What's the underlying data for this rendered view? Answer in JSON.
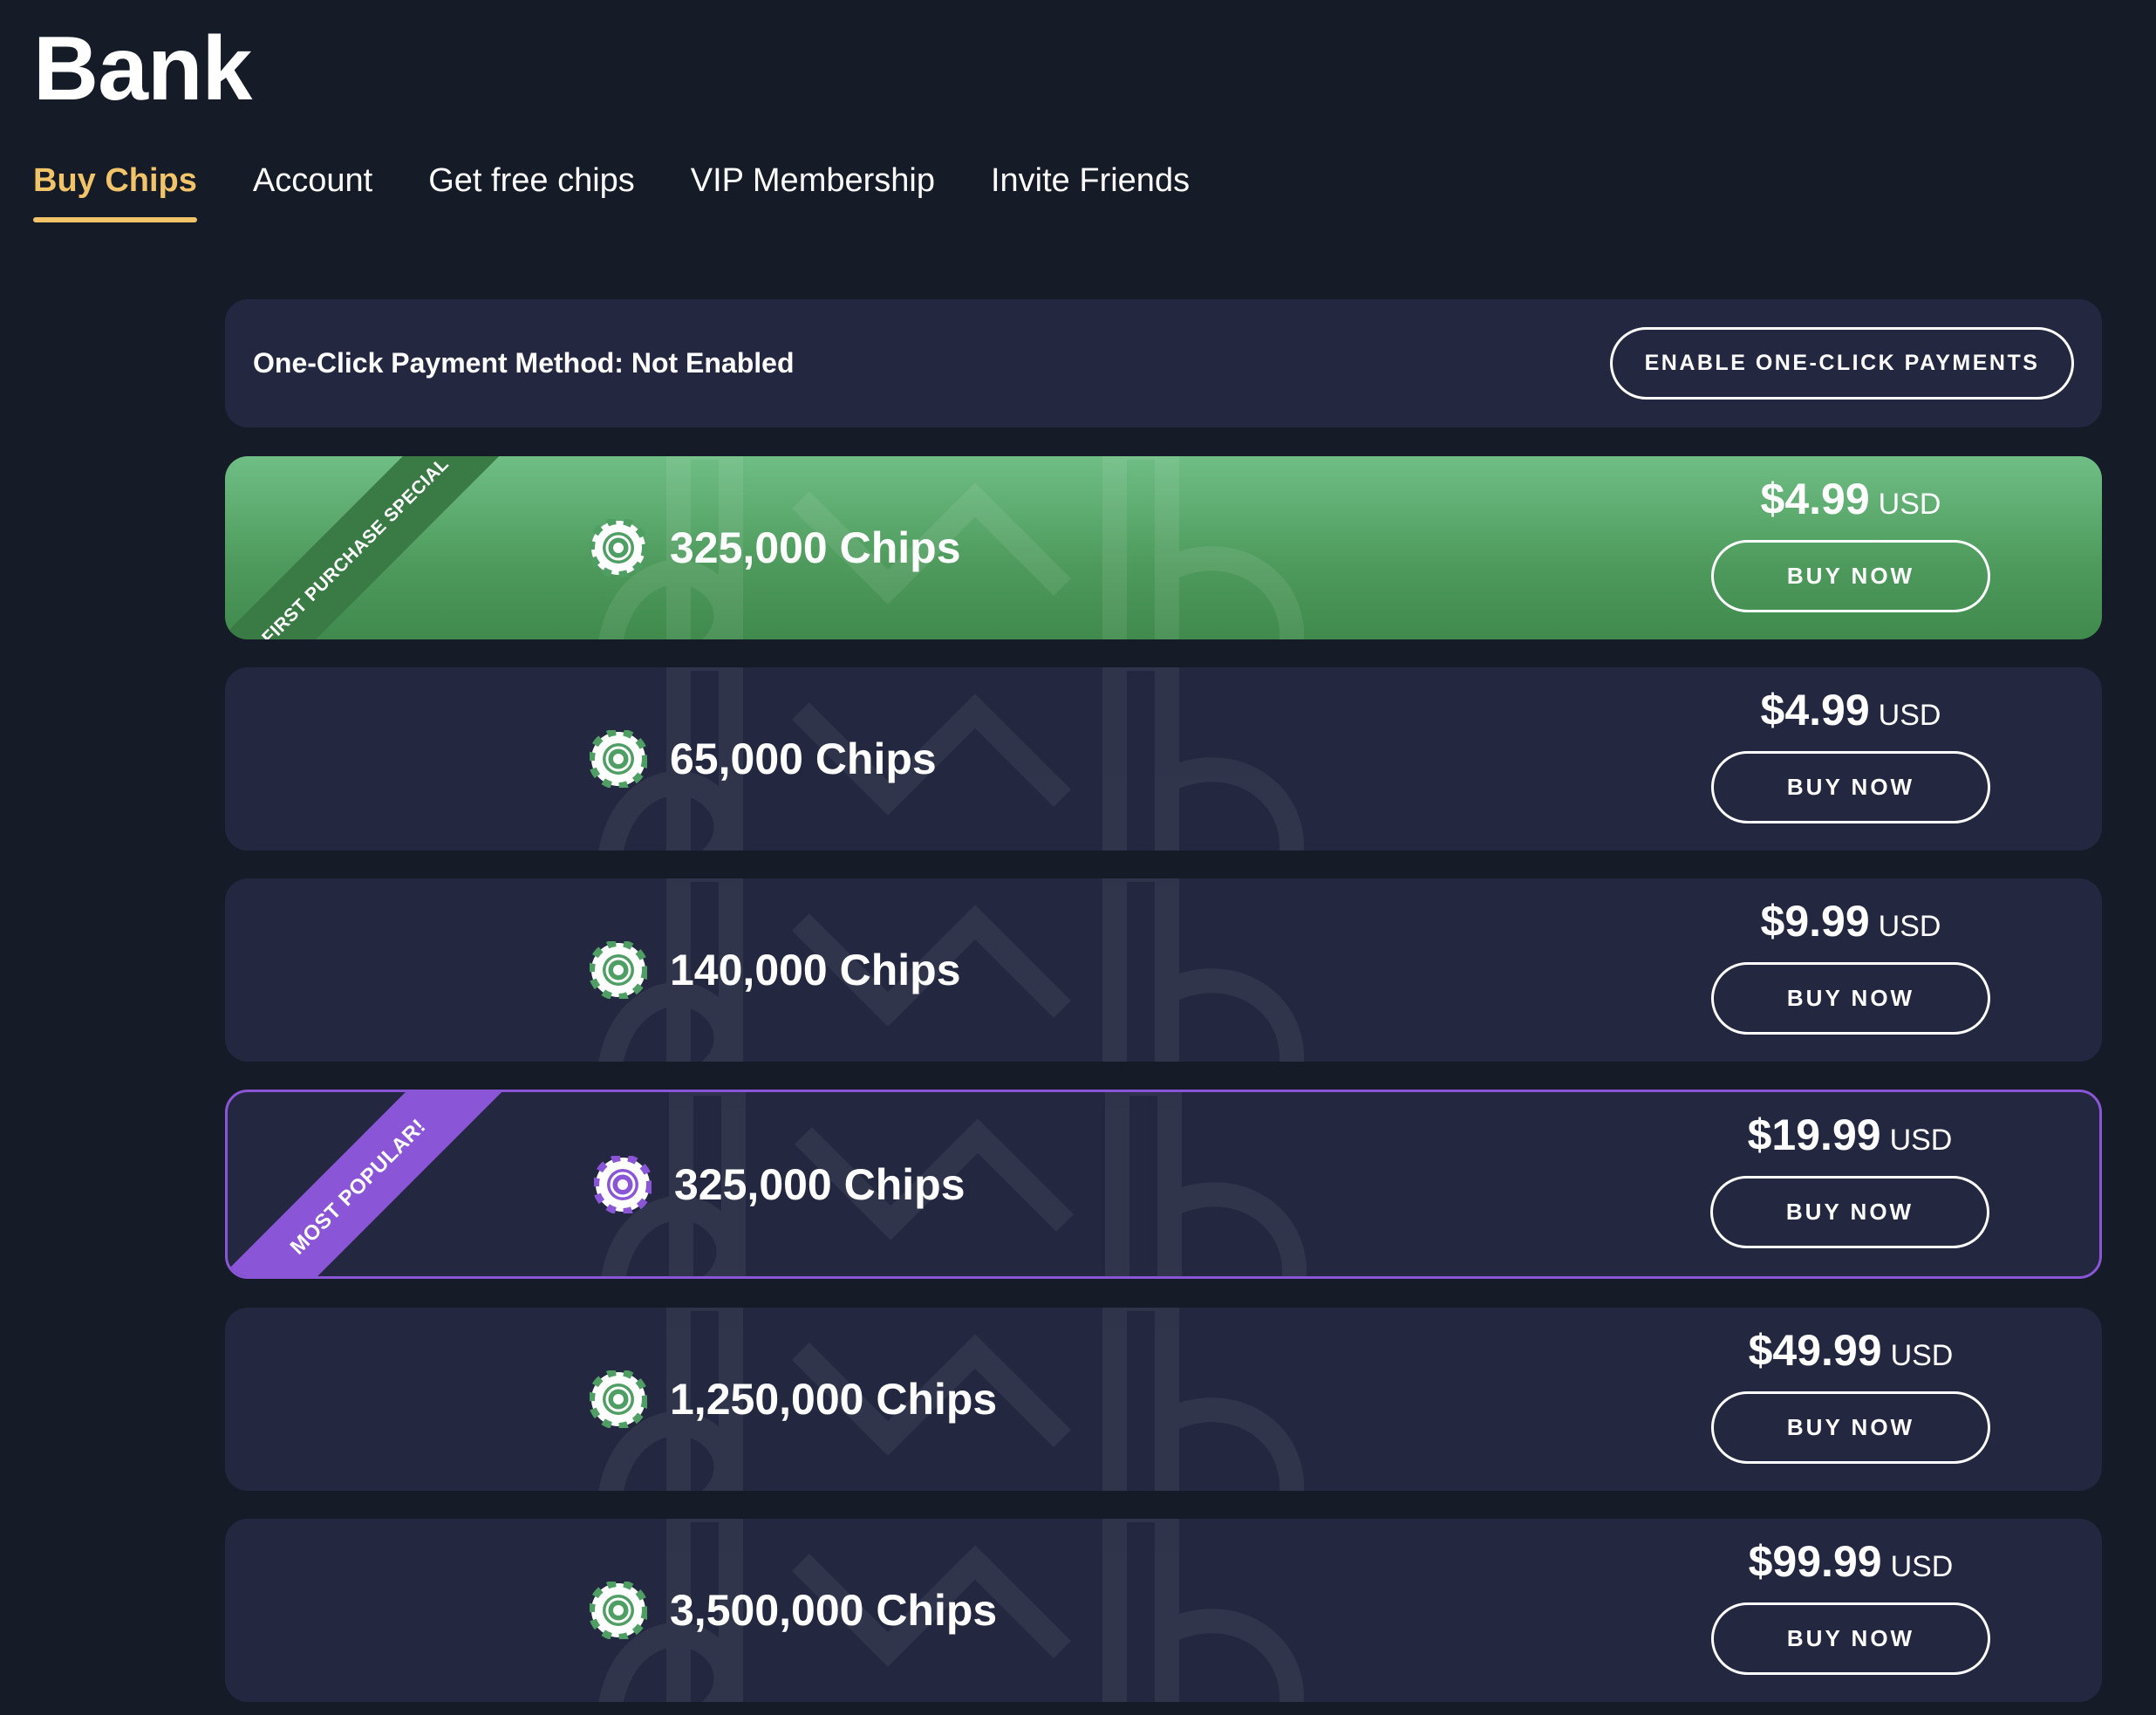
{
  "page": {
    "title": "Bank"
  },
  "tabs": [
    {
      "label": "Buy Chips",
      "active": true
    },
    {
      "label": "Account",
      "active": false
    },
    {
      "label": "Get free chips",
      "active": false
    },
    {
      "label": "VIP Membership",
      "active": false
    },
    {
      "label": "Invite Friends",
      "active": false
    }
  ],
  "payment": {
    "status_text": "One-Click Payment Method: Not Enabled",
    "enable_label": "ENABLE ONE-CLICK PAYMENTS"
  },
  "packages": [
    {
      "chips": "325,000 Chips",
      "price": "$4.99",
      "currency": "USD",
      "button": "BUY NOW",
      "ribbon": "FIRST PURCHASE SPECIAL",
      "style": "green"
    },
    {
      "chips": "65,000 Chips",
      "price": "$4.99",
      "currency": "USD",
      "button": "BUY NOW",
      "ribbon": "",
      "style": "default"
    },
    {
      "chips": "140,000 Chips",
      "price": "$9.99",
      "currency": "USD",
      "button": "BUY NOW",
      "ribbon": "",
      "style": "default"
    },
    {
      "chips": "325,000 Chips",
      "price": "$19.99",
      "currency": "USD",
      "button": "BUY NOW",
      "ribbon": "MOST POPULAR!",
      "style": "purple"
    },
    {
      "chips": "1,250,000 Chips",
      "price": "$49.99",
      "currency": "USD",
      "button": "BUY NOW",
      "ribbon": "",
      "style": "default"
    },
    {
      "chips": "3,500,000 Chips",
      "price": "$99.99",
      "currency": "USD",
      "button": "BUY NOW",
      "ribbon": "",
      "style": "default"
    }
  ],
  "colors": {
    "background": "#151b27",
    "panel": "#232840",
    "accent_tab": "#f2c46a",
    "green_card": "#5aa86a",
    "green_ribbon": "#3a7a45",
    "purple": "#8a55d6",
    "chip_green": "#4f9e63",
    "chip_purple": "#8a55d6"
  },
  "icons": {
    "chip": "poker-chip-icon"
  }
}
